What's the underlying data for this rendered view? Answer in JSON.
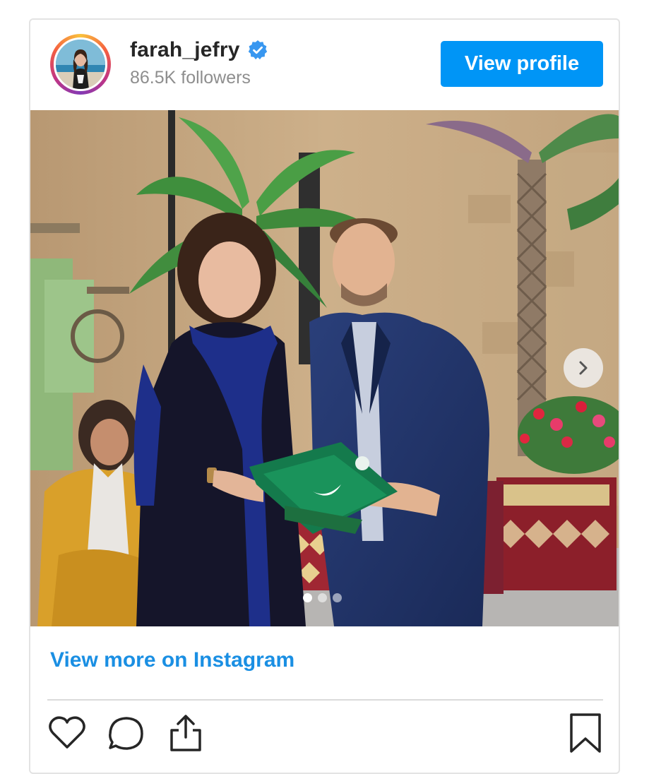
{
  "post": {
    "username": "farah_jefry",
    "verified": true,
    "followers": "86.5K followers",
    "view_profile_label": "View profile",
    "view_more_label": "View more on Instagram",
    "carousel": {
      "total": 3,
      "current": 1
    }
  },
  "colors": {
    "accent": "#0095f6",
    "link": "#1a8fe3",
    "username": "#262626",
    "muted": "#8e8e8e"
  },
  "icons": {
    "verified": "verified-badge-icon",
    "next": "chevron-right-icon",
    "like": "heart-icon",
    "comment": "comment-icon",
    "share": "share-icon",
    "save": "bookmark-icon"
  }
}
